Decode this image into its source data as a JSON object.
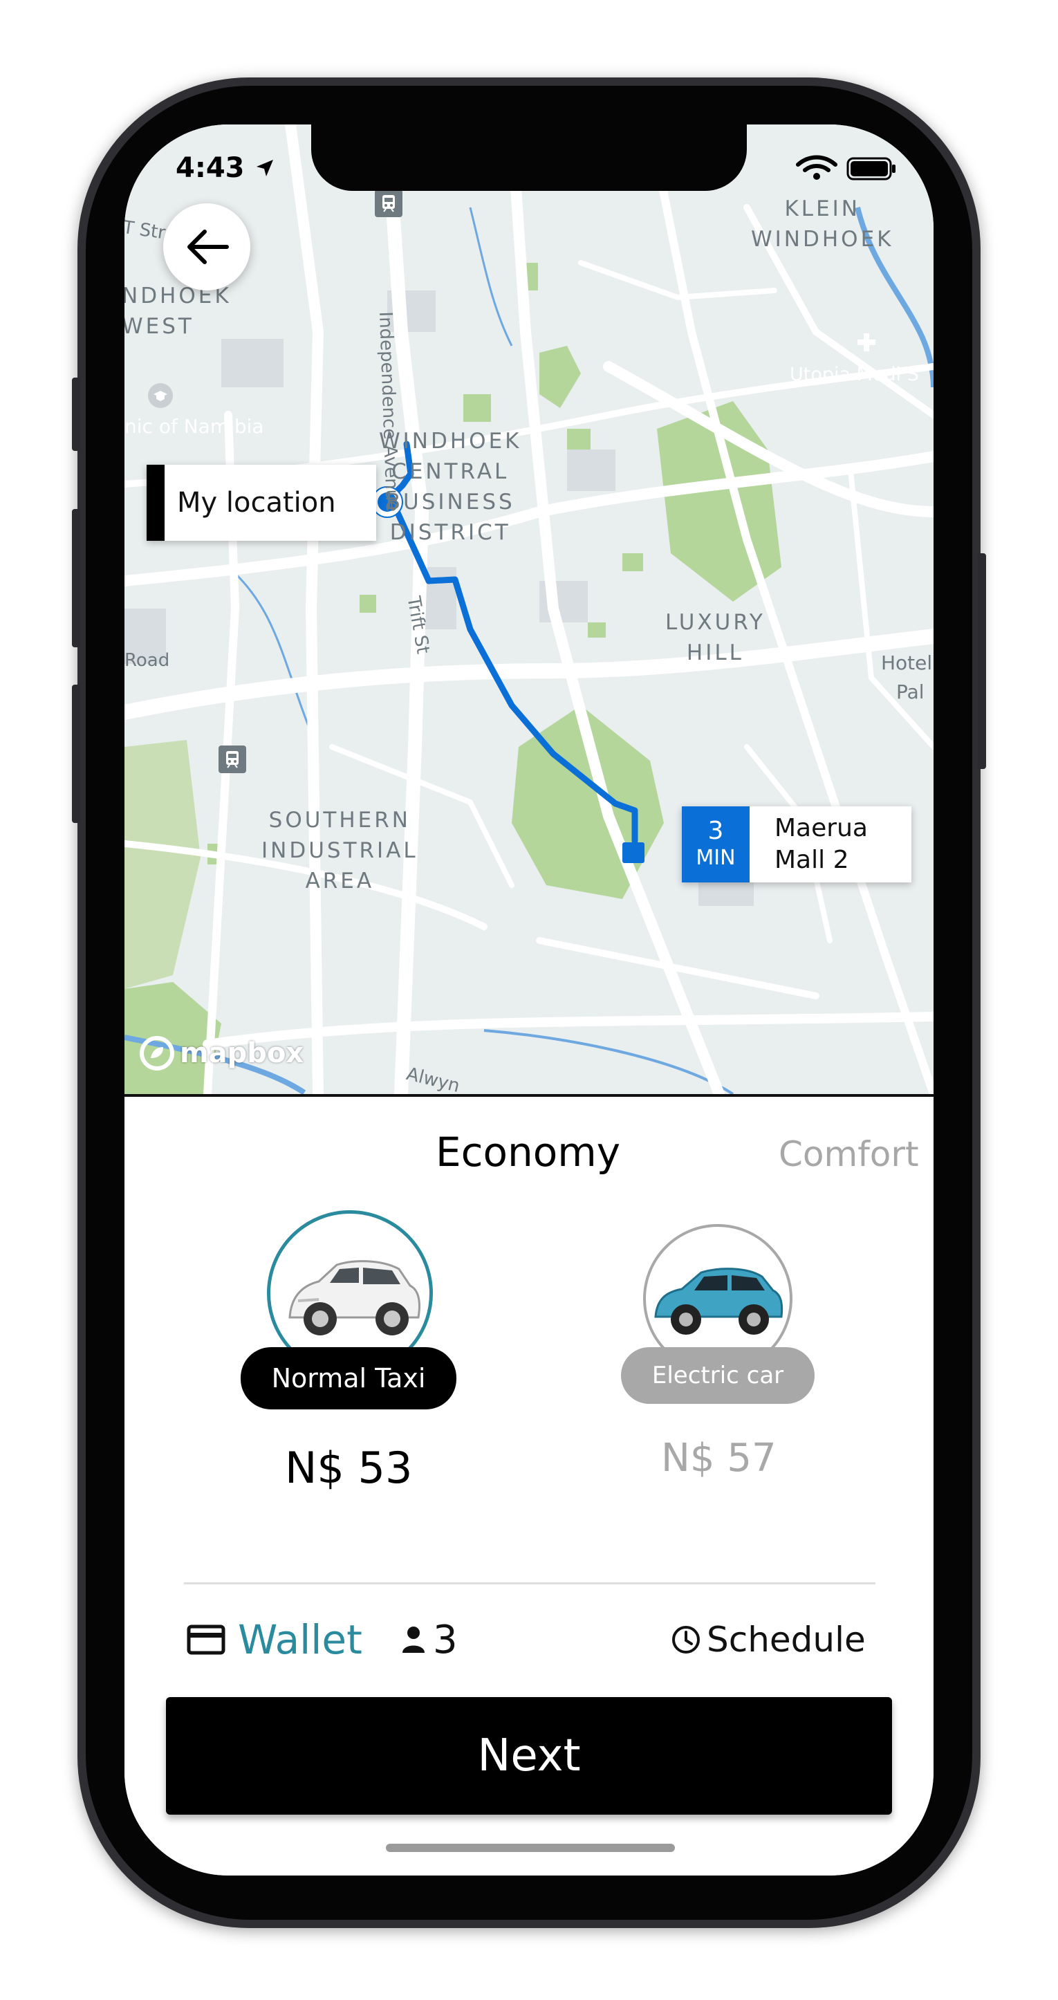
{
  "status": {
    "time": "4:43"
  },
  "map": {
    "area_labels": [
      "KLEIN\nWINDHOEK",
      "NDHOEK\nWEST",
      "WINDHOEK\nCENTRAL\nBUSINESS\nDISTRICT",
      "LUXURY\nHILL",
      "SOUTHERN\nINDUSTRIAL\nAREA"
    ],
    "street_labels": [
      "Independence Avenue",
      "Trift St",
      "Road",
      "Alwyn",
      "T Stre",
      "Utopia Medi S",
      "Hotel",
      "Pal",
      "nic of Namibia"
    ],
    "my_location_label": "My location",
    "eta_value": "3",
    "eta_unit": "MIN",
    "destination_line1": "Maerua",
    "destination_line2": "Mall 2",
    "attribution": "mapbox",
    "route_color": "#0a6fd6"
  },
  "sheet": {
    "tabs": [
      "Economy",
      "Comfort"
    ],
    "options": [
      {
        "name": "Normal Taxi",
        "price": "N$ 53",
        "selected": true
      },
      {
        "name": "Electric car",
        "price": "N$ 57",
        "selected": false
      }
    ],
    "payment_label": "Wallet",
    "passengers": "3",
    "schedule_label": "Schedule",
    "next_label": "Next",
    "accent_color": "#2a8a9e"
  },
  "icons": [
    "back-arrow-icon",
    "location-arrow-icon",
    "wifi-icon",
    "battery-icon",
    "train-station-icon",
    "hospital-icon",
    "school-icon",
    "card-icon",
    "person-icon",
    "clock-icon",
    "mapbox-logo-icon"
  ]
}
